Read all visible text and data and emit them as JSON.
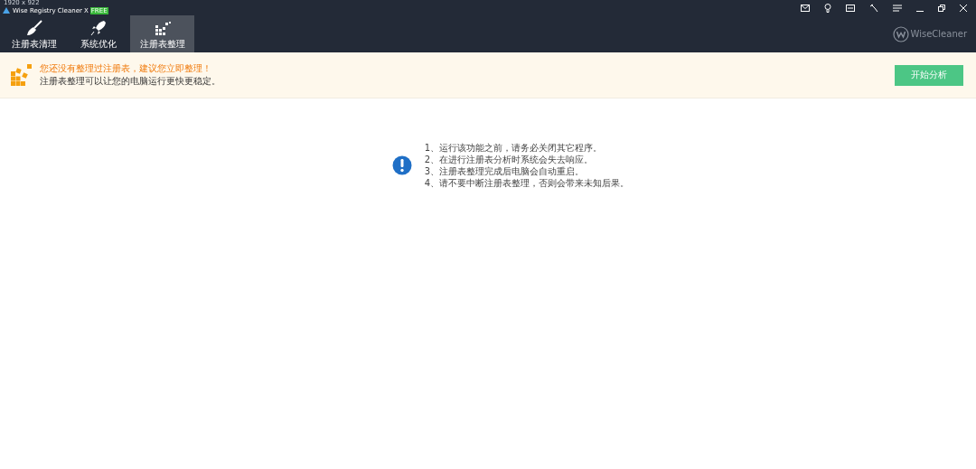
{
  "overlay_text": "1920 x 922",
  "window": {
    "title": "Wise Registry Cleaner X",
    "badge": "FREE"
  },
  "tabs": [
    {
      "label": "注册表清理",
      "kind": "broom",
      "selected": false
    },
    {
      "label": "系统优化",
      "kind": "rocket",
      "selected": false
    },
    {
      "label": "注册表整理",
      "kind": "blocks",
      "selected": true
    }
  ],
  "brand": "WiseCleaner",
  "banner": {
    "headline": "您还没有整理过注册表，建议您立即整理！",
    "subtext": "注册表整理可以让您的电脑运行更快更稳定。",
    "button": "开始分析"
  },
  "notes": [
    "1、运行该功能之前，请务必关闭其它程序。",
    "2、在进行注册表分析时系统会失去响应。",
    "3、注册表整理完成后电脑会自动重启。",
    "4、请不要中断注册表整理，否则会带来未知后果。"
  ]
}
